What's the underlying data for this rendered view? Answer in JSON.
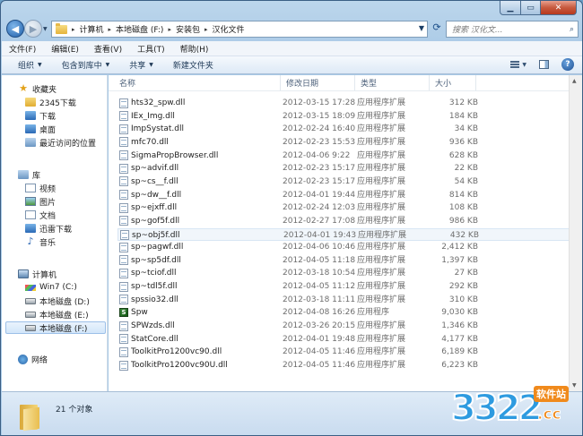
{
  "address": {
    "crumbs": [
      "计算机",
      "本地磁盘 (F:)",
      "安装包",
      "汉化文件"
    ],
    "search_placeholder": "搜索 汉化文..."
  },
  "menu": [
    "文件(F)",
    "编辑(E)",
    "查看(V)",
    "工具(T)",
    "帮助(H)"
  ],
  "toolbar": {
    "organize": "组织",
    "include_library": "包含到库中",
    "share": "共享",
    "new_folder": "新建文件夹"
  },
  "nav": {
    "favorites": "收藏夹",
    "fav_items": [
      "2345下载",
      "下载",
      "桌面",
      "最近访问的位置"
    ],
    "libraries": "库",
    "lib_items": [
      "视频",
      "图片",
      "文档",
      "迅雷下载",
      "音乐"
    ],
    "computer": "计算机",
    "drives": [
      "Win7 (C:)",
      "本地磁盘 (D:)",
      "本地磁盘 (E:)",
      "本地磁盘 (F:)"
    ],
    "network": "网络"
  },
  "columns": {
    "name": "名称",
    "date": "修改日期",
    "type": "类型",
    "size": "大小"
  },
  "files": [
    {
      "name": "hts32_spw.dll",
      "date": "2012-03-15 17:28",
      "type": "应用程序扩展",
      "size": "312 KB"
    },
    {
      "name": "IEx_Img.dll",
      "date": "2012-03-15 18:09",
      "type": "应用程序扩展",
      "size": "184 KB"
    },
    {
      "name": "ImpSystat.dll",
      "date": "2012-02-24 16:40",
      "type": "应用程序扩展",
      "size": "34 KB"
    },
    {
      "name": "mfc70.dll",
      "date": "2012-02-23 15:53",
      "type": "应用程序扩展",
      "size": "936 KB"
    },
    {
      "name": "SigmaPropBrowser.dll",
      "date": "2012-04-06 9:22",
      "type": "应用程序扩展",
      "size": "628 KB"
    },
    {
      "name": "sp~advif.dll",
      "date": "2012-02-23 15:17",
      "type": "应用程序扩展",
      "size": "22 KB"
    },
    {
      "name": "sp~cs__f.dll",
      "date": "2012-02-23 15:17",
      "type": "应用程序扩展",
      "size": "54 KB"
    },
    {
      "name": "sp~dw__f.dll",
      "date": "2012-04-01 19:44",
      "type": "应用程序扩展",
      "size": "814 KB"
    },
    {
      "name": "sp~ejxff.dll",
      "date": "2012-02-24 12:03",
      "type": "应用程序扩展",
      "size": "108 KB"
    },
    {
      "name": "sp~gof5f.dll",
      "date": "2012-02-27 17:08",
      "type": "应用程序扩展",
      "size": "986 KB"
    },
    {
      "name": "sp~obj5f.dll",
      "date": "2012-04-01 19:43",
      "type": "应用程序扩展",
      "size": "432 KB"
    },
    {
      "name": "sp~pagwf.dll",
      "date": "2012-04-06 10:46",
      "type": "应用程序扩展",
      "size": "2,412 KB"
    },
    {
      "name": "sp~sp5df.dll",
      "date": "2012-04-05 11:18",
      "type": "应用程序扩展",
      "size": "1,397 KB"
    },
    {
      "name": "sp~tciof.dll",
      "date": "2012-03-18 10:54",
      "type": "应用程序扩展",
      "size": "27 KB"
    },
    {
      "name": "sp~tdl5f.dll",
      "date": "2012-04-05 11:12",
      "type": "应用程序扩展",
      "size": "292 KB"
    },
    {
      "name": "spssio32.dll",
      "date": "2012-03-18 11:11",
      "type": "应用程序扩展",
      "size": "310 KB"
    },
    {
      "name": "Spw",
      "date": "2012-04-08 16:26",
      "type": "应用程序",
      "size": "9,030 KB"
    },
    {
      "name": "SPWzds.dll",
      "date": "2012-03-26 20:15",
      "type": "应用程序扩展",
      "size": "1,346 KB"
    },
    {
      "name": "StatCore.dll",
      "date": "2012-04-01 19:48",
      "type": "应用程序扩展",
      "size": "4,177 KB"
    },
    {
      "name": "ToolkitPro1200vc90.dll",
      "date": "2012-04-05 11:46",
      "type": "应用程序扩展",
      "size": "6,189 KB"
    },
    {
      "name": "ToolkitPro1200vc90U.dll",
      "date": "2012-04-05 11:46",
      "type": "应用程序扩展",
      "size": "6,223 KB"
    }
  ],
  "status": {
    "count": "21 个对象"
  },
  "watermark": {
    "number": "3322",
    "site": "软件站",
    "domain": ".cc"
  }
}
